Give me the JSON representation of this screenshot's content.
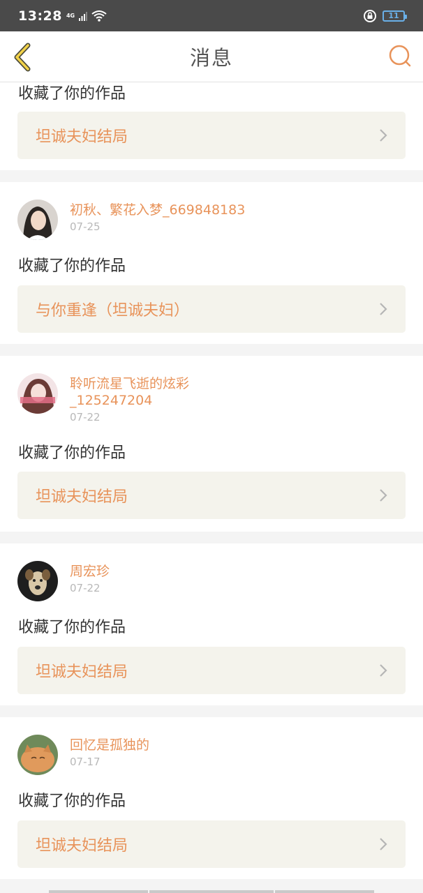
{
  "status_bar": {
    "time": "13:28",
    "network": "4G",
    "battery": "11"
  },
  "header": {
    "title": "消息"
  },
  "colors": {
    "accent": "#e8935a",
    "card_bg": "#f4f3ec"
  },
  "first_item": {
    "action": "收藏了你的作品",
    "work_title": "坦诚夫妇结局"
  },
  "items": [
    {
      "username": "初秋、繁花入梦_669848183",
      "date": "07-25",
      "action": "收藏了你的作品",
      "work_title": "与你重逢（坦诚夫妇）"
    },
    {
      "username": "聆听流星飞逝的炫彩_125247204",
      "date": "07-22",
      "action": "收藏了你的作品",
      "work_title": "坦诚夫妇结局"
    },
    {
      "username": "周宏珍",
      "date": "07-22",
      "action": "收藏了你的作品",
      "work_title": "坦诚夫妇结局"
    },
    {
      "username": "回忆是孤独的",
      "date": "07-17",
      "action": "收藏了你的作品",
      "work_title": "坦诚夫妇结局"
    }
  ]
}
